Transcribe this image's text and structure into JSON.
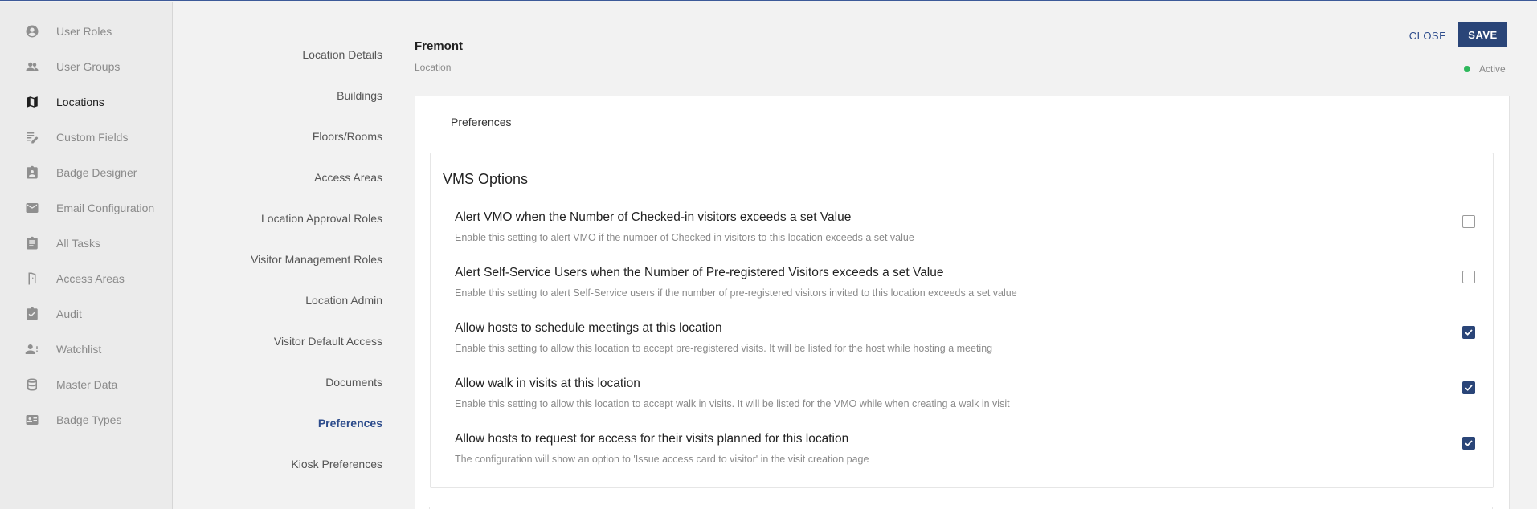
{
  "nav": {
    "items": [
      {
        "label": "User Roles",
        "icon": "account-circle-icon"
      },
      {
        "label": "User Groups",
        "icon": "people-icon"
      },
      {
        "label": "Locations",
        "icon": "map-icon",
        "active": true
      },
      {
        "label": "Custom Fields",
        "icon": "edit-note-icon"
      },
      {
        "label": "Badge Designer",
        "icon": "badge-icon"
      },
      {
        "label": "Email Configuration",
        "icon": "email-icon"
      },
      {
        "label": "All Tasks",
        "icon": "assignment-icon"
      },
      {
        "label": "Access Areas",
        "icon": "door-icon"
      },
      {
        "label": "Audit",
        "icon": "assignment-check-icon"
      },
      {
        "label": "Watchlist",
        "icon": "person-alert-icon"
      },
      {
        "label": "Master Data",
        "icon": "database-icon"
      },
      {
        "label": "Badge Types",
        "icon": "id-card-icon"
      }
    ]
  },
  "subnav": {
    "items": [
      {
        "label": "Location Details"
      },
      {
        "label": "Buildings"
      },
      {
        "label": "Floors/Rooms"
      },
      {
        "label": "Access Areas"
      },
      {
        "label": "Location Approval Roles"
      },
      {
        "label": "Visitor Management Roles"
      },
      {
        "label": "Location Admin"
      },
      {
        "label": "Visitor Default Access"
      },
      {
        "label": "Documents"
      },
      {
        "label": "Preferences",
        "active": true
      },
      {
        "label": "Kiosk Preferences"
      }
    ]
  },
  "header": {
    "location_name": "Fremont",
    "location_subtitle": "Location",
    "close_label": "CLOSE",
    "save_label": "SAVE",
    "status": "Active"
  },
  "card": {
    "tab_label": "Preferences",
    "section_title": "VMS Options",
    "options": [
      {
        "title": "Alert VMO when the Number of Checked-in visitors exceeds a set Value",
        "description": "Enable this setting to alert VMO if the number of Checked in visitors to this location exceeds a set value",
        "checked": false
      },
      {
        "title": "Alert Self-Service Users when the Number of Pre-registered Visitors exceeds a set Value",
        "description": "Enable this setting to alert Self-Service users if the number of pre-registered visitors invited to this location exceeds a set value",
        "checked": false
      },
      {
        "title": "Allow hosts to schedule meetings at this location",
        "description": "Enable this setting to allow this location to accept pre-registered visits. It will be listed for the host while hosting a meeting",
        "checked": true
      },
      {
        "title": "Allow walk in visits at this location",
        "description": "Enable this setting to allow this location to accept walk in visits. It will be listed for the VMO while when creating a walk in visit",
        "checked": true
      },
      {
        "title": "Allow hosts to request for access for their visits planned for this location",
        "description": "The configuration will show an option to 'Issue access card to visitor' in the visit creation page",
        "checked": true
      }
    ]
  },
  "colors": {
    "accent": "#2a4578",
    "active_link": "#2d4c8c",
    "status_active": "#2eb85c"
  }
}
